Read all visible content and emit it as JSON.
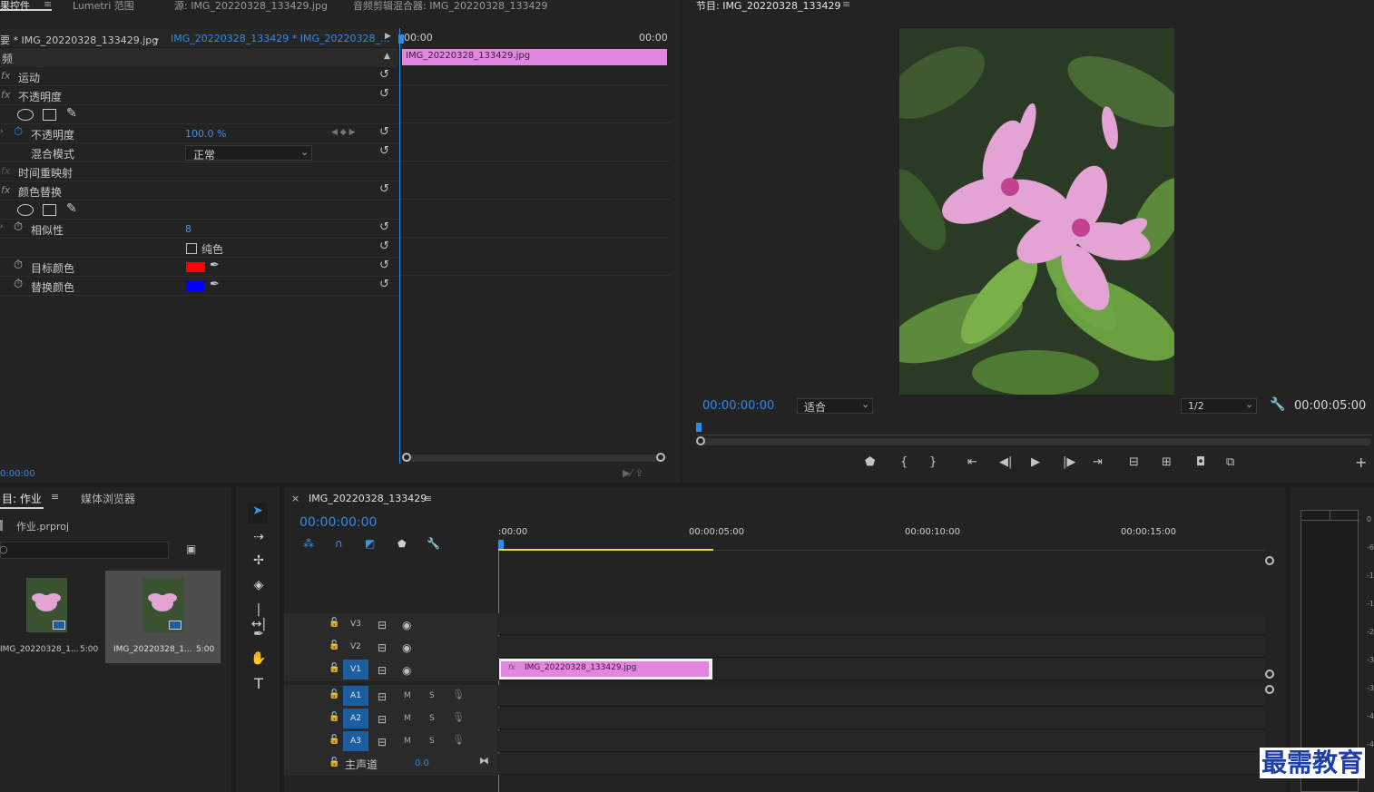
{
  "effect_controls": {
    "tabs": [
      "果控件",
      "Lumetri 范围",
      "源: IMG_20220328_133429.jpg",
      "音频剪辑混合器: IMG_20220328_133429"
    ],
    "menu_glyph": "≡",
    "source_label": "要 * IMG_20220328_133429.jpg",
    "sequence_dropdown": "IMG_20220328_133429 * IMG_20220328_...",
    "section_header": "频",
    "effects": {
      "motion": "运动",
      "opacity": "不透明度",
      "opacity_prop": "不透明度",
      "opacity_value": "100.0 %",
      "blend_mode_label": "混合模式",
      "blend_mode_value": "正常",
      "time_remap": "时间重映射",
      "color_replace": "颜色替换",
      "similarity_label": "相似性",
      "similarity_value": "8",
      "solid_color_label": "纯色",
      "target_color_label": "目标颜色",
      "target_color": "#ff0000",
      "replace_color_label": "替换颜色",
      "replace_color": "#0000ff"
    },
    "mini_timeline": {
      "start": "00:00",
      "end": "00:00",
      "clip": "IMG_20220328_133429.jpg"
    },
    "timecode": "0:00:00"
  },
  "program_monitor": {
    "title": "节目: IMG_20220328_133429",
    "timecode_current": "00:00:00:00",
    "zoom": "适合",
    "resolution": "1/2",
    "timecode_duration": "00:00:05:00"
  },
  "project": {
    "tabs": [
      "目: 作业",
      "媒体浏览器"
    ],
    "file": "作业.prproj",
    "items": [
      {
        "name": "IMG_20220328_1...",
        "duration": "5:00"
      },
      {
        "name": "IMG_20220328_1...",
        "duration": "5:00"
      }
    ]
  },
  "timeline": {
    "close": "×",
    "title": "IMG_20220328_133429",
    "timecode": "00:00:00:00",
    "ruler": [
      ":00:00",
      "00:00:05:00",
      "00:00:10:00",
      "00:00:15:00"
    ],
    "video_tracks": [
      "V3",
      "V2",
      "V1"
    ],
    "audio_tracks": [
      "A1",
      "A2",
      "A3"
    ],
    "m_label": "M",
    "s_label": "S",
    "master_label": "主声道",
    "master_value": "0.0",
    "clip": "IMG_20220328_133429.jpg"
  },
  "meter": {
    "ticks": [
      "0",
      "-6",
      "-1",
      "-1",
      "-2",
      "-3",
      "-3",
      "-4",
      "-4"
    ]
  },
  "watermark": "最需教育",
  "colors": {
    "accent": "#2d8ceb",
    "clip_pink": "#e386e0",
    "yellow_bar": "#e6dc2a"
  }
}
